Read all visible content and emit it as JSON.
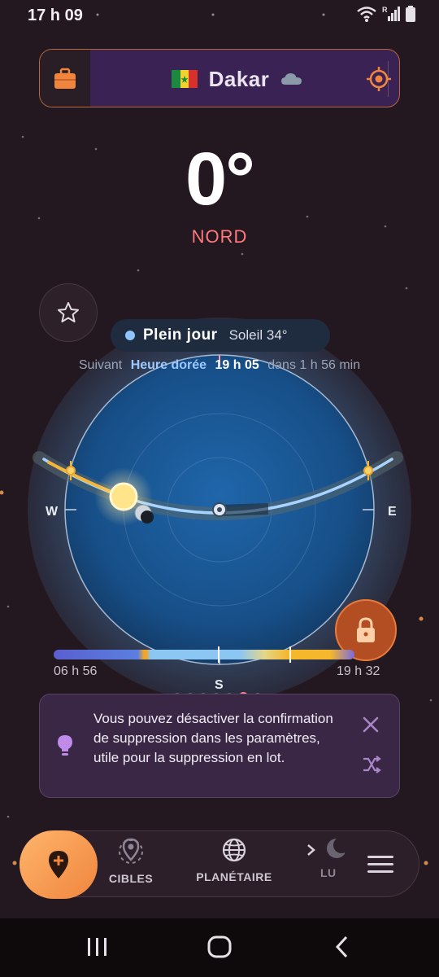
{
  "status": {
    "time": "17 h 09"
  },
  "location": {
    "city": "Dakar",
    "flag": "senegal-flag",
    "weather_icon": "cloud-icon"
  },
  "heading": {
    "degrees": "0°",
    "direction": "NORD"
  },
  "sun_phase": {
    "label": "Plein jour",
    "sun_altitude": "Soleil 34°",
    "next_prefix": "Suivant",
    "next_phase": "Heure dorée",
    "next_time": "19 h 05",
    "next_in": "dans 1 h 56 min"
  },
  "compass": {
    "west": "W",
    "east": "E",
    "south": "S"
  },
  "day_timeline": {
    "start": "06 h 56",
    "end": "19 h 32"
  },
  "pager": {
    "count": 7,
    "active_index": 5
  },
  "tip": {
    "text": "Vous pouvez désactiver la confirmation de suppression dans les paramètres, utile pour la suppression en lot."
  },
  "nav": {
    "items": [
      {
        "label": "CIBLES",
        "icon": "target-pin-icon"
      },
      {
        "label": "PLANÉTAIRE",
        "icon": "globe-icon"
      },
      {
        "label": "LU",
        "icon": "moon-icon"
      }
    ]
  },
  "colors": {
    "accent_orange": "#f0853e",
    "heading_red": "#ff7a7a",
    "sky_blue": "#1c5a9a",
    "phase_dot": "#8fc4ff"
  }
}
